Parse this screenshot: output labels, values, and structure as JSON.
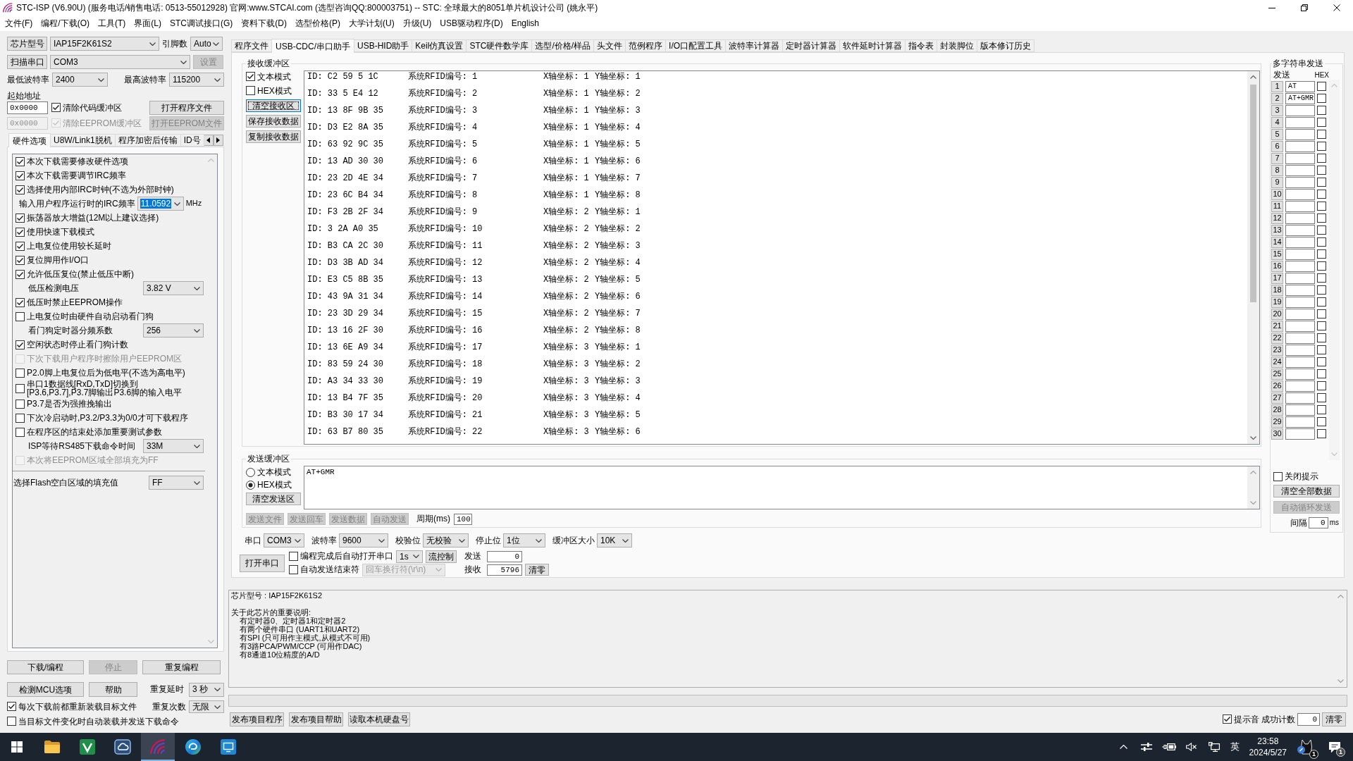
{
  "window": {
    "title": "STC-ISP (V6.90U) (服务电话/销售电话: 0513-55012928) 官网:www.STCAI.com  (选型咨询QQ:800003751) -- STC: 全球最大的8051单片机设计公司 (姚永平)"
  },
  "menu": [
    "文件(F)",
    "编程/下载(O)",
    "工具(T)",
    "界面(L)",
    "STC调试接口(G)",
    "资料下载(D)",
    "选型价格(P)",
    "大学计划(U)",
    "升级(U)",
    "USB驱动程序(D)",
    "English"
  ],
  "target": {
    "chip": {
      "button": "芯片型号",
      "value": "IAP15F2K61S2"
    },
    "pins": {
      "label": "引脚数",
      "value": "Auto"
    },
    "port": {
      "button": "扫描串口",
      "value": "COM3"
    },
    "setup_button": {
      "label": "设置",
      "disabled": true
    },
    "min_baud": {
      "label": "最低波特率",
      "value": "2400"
    },
    "max_baud": {
      "label": "最高波特率",
      "value": "115200"
    },
    "address_label": "起始地址",
    "buffers": [
      {
        "address": "0x0000",
        "clear_label": "清除代码缓冲区",
        "checked": true,
        "button": "打开程序文件",
        "disabled": false
      },
      {
        "address": "0x0000",
        "clear_label": "清除EEPROM缓冲区",
        "checked": true,
        "button": "打开EEPROM文件",
        "disabled": true
      }
    ]
  },
  "option_tabs": [
    {
      "label": "硬件选项",
      "selected": true
    },
    {
      "label": "U8W/Link1脱机",
      "selected": false
    },
    {
      "label": "程序加密后传输",
      "selected": false
    },
    {
      "label": "ID号",
      "selected": false
    }
  ],
  "hardware_options": [
    {
      "kind": "checkbox",
      "label": "本次下载需要修改硬件选项",
      "checked": true,
      "disabled": false
    },
    {
      "kind": "checkbox",
      "label": "本次下载需要调节IRC频率",
      "checked": true,
      "disabled": false
    },
    {
      "kind": "checkbox",
      "label": "选择使用内部IRC时钟(不选为外部时钟)",
      "checked": true,
      "disabled": false
    },
    {
      "kind": "frequency",
      "label": "输入用户程序运行时的IRC频率",
      "value": "11.0592",
      "highlighted": true,
      "unit": "MHz"
    },
    {
      "kind": "checkbox",
      "label": "振荡器放大增益(12M以上建议选择)",
      "checked": true,
      "disabled": false
    },
    {
      "kind": "checkbox",
      "label": "使用快速下载模式",
      "checked": true,
      "disabled": false
    },
    {
      "kind": "checkbox",
      "label": "上电复位使用较长延时",
      "checked": true,
      "disabled": false
    },
    {
      "kind": "checkbox",
      "label": "复位脚用作I/O口",
      "checked": true,
      "disabled": false
    },
    {
      "kind": "checkbox",
      "label": "允许低压复位(禁止低压中断)",
      "checked": true,
      "disabled": false
    },
    {
      "kind": "select",
      "label": "低压检测电压",
      "value": "3.82 V"
    },
    {
      "kind": "checkbox",
      "label": "低压时禁止EEPROM操作",
      "checked": true,
      "disabled": false
    },
    {
      "kind": "checkbox",
      "label": "上电复位时由硬件自动启动看门狗",
      "checked": false,
      "disabled": false
    },
    {
      "kind": "select",
      "label": "看门狗定时器分频系数",
      "value": "256"
    },
    {
      "kind": "checkbox",
      "label": "空闲状态时停止看门狗计数",
      "checked": true,
      "disabled": false
    },
    {
      "kind": "checkbox",
      "label": "下次下载用户程序时擦除用户EEPROM区",
      "checked": false,
      "disabled": true
    },
    {
      "kind": "checkbox",
      "label": "P2.0脚上电复位后为低电平(不选为高电平)",
      "checked": false,
      "disabled": false
    },
    {
      "kind": "checkbox",
      "label": "串口1数据线[RxD,TxD]切换到\n[P3.6,P3.7],P3.7脚输出P3.6脚的输入电平",
      "checked": false,
      "disabled": false
    },
    {
      "kind": "checkbox",
      "label": "P3.7是否为强推挽输出",
      "checked": false,
      "disabled": false
    },
    {
      "kind": "checkbox",
      "label": "下次冷启动时,P3.2/P3.3为0/0才可下载程序",
      "checked": false,
      "disabled": false
    },
    {
      "kind": "checkbox",
      "label": "在程序区的结束处添加重要测试参数",
      "checked": false,
      "disabled": false
    },
    {
      "kind": "select",
      "label": "ISP等待RS485下载命令时间",
      "value": "33M"
    },
    {
      "kind": "checkbox",
      "label": "本次将EEPROM区域全部填充为FF",
      "checked": false,
      "disabled": true
    },
    {
      "kind": "fill-select",
      "label": "选择Flash空白区域的填充值",
      "value": "FF"
    }
  ],
  "download": {
    "buttons": [
      {
        "label": "下载/编程",
        "disabled": false
      },
      {
        "label": "停止",
        "disabled": true
      },
      {
        "label": "重复编程",
        "disabled": false
      },
      {
        "label": "检测MCU选项",
        "disabled": false
      },
      {
        "label": "帮助",
        "disabled": false
      }
    ],
    "repeat_delay": {
      "label": "重复延时",
      "value": "3 秒"
    },
    "repeat_count": {
      "label": "重复次数",
      "value": "无限"
    },
    "reload": [
      {
        "label": "每次下载前都重新装载目标文件",
        "checked": true
      },
      {
        "label": "当目标文件变化时自动装载并发送下载命令",
        "checked": false
      }
    ]
  },
  "tabs": [
    {
      "label": "程序文件",
      "selected": false
    },
    {
      "label": "USB-CDC/串口助手",
      "selected": true
    },
    {
      "label": "USB-HID助手",
      "selected": false
    },
    {
      "label": "Keil仿真设置",
      "selected": false
    },
    {
      "label": "STC硬件数学库",
      "selected": false
    },
    {
      "label": "选型/价格/样品",
      "selected": false
    },
    {
      "label": "头文件",
      "selected": false
    },
    {
      "label": "范例程序",
      "selected": false
    },
    {
      "label": "I/O口配置工具",
      "selected": false
    },
    {
      "label": "波特率计算器",
      "selected": false
    },
    {
      "label": "定时器计算器",
      "selected": false
    },
    {
      "label": "软件延时计算器",
      "selected": false
    },
    {
      "label": "指令表",
      "selected": false
    },
    {
      "label": "封装脚位",
      "selected": false
    },
    {
      "label": "版本修订历史",
      "selected": false
    }
  ],
  "receive": {
    "title": "接收缓冲区",
    "modes": [
      {
        "label": "文本模式",
        "checked": true
      },
      {
        "label": "HEX模式",
        "checked": false
      }
    ],
    "buttons": [
      {
        "label": "清空接收区",
        "focused": true
      },
      {
        "label": "保存接收数据",
        "focused": false
      },
      {
        "label": "复制接收数据",
        "focused": false
      }
    ],
    "rows": [
      {
        "id": "ID: C2 59 5 1C",
        "number_label": "系统RFID编号:",
        "number": "1",
        "x": "X轴坐标: 1",
        "y": "Y轴坐标: 1"
      },
      {
        "id": "ID: 33 5 E4 12",
        "number_label": "系统RFID编号:",
        "number": "2",
        "x": "X轴坐标: 1",
        "y": "Y轴坐标: 2"
      },
      {
        "id": "ID: 13 8F 9B 35",
        "number_label": "系统RFID编号:",
        "number": "3",
        "x": "X轴坐标: 1",
        "y": "Y轴坐标: 3"
      },
      {
        "id": "ID: D3 E2 8A 35",
        "number_label": "系统RFID编号:",
        "number": "4",
        "x": "X轴坐标: 1",
        "y": "Y轴坐标: 4"
      },
      {
        "id": "ID: 63 92 9C 35",
        "number_label": "系统RFID编号:",
        "number": "5",
        "x": "X轴坐标: 1",
        "y": "Y轴坐标: 5"
      },
      {
        "id": "ID: 13 AD 30 30",
        "number_label": "系统RFID编号:",
        "number": "6",
        "x": "X轴坐标: 1",
        "y": "Y轴坐标: 6"
      },
      {
        "id": "ID: 23 2D 4E 34",
        "number_label": "系统RFID编号:",
        "number": "7",
        "x": "X轴坐标: 1",
        "y": "Y轴坐标: 7"
      },
      {
        "id": "ID: 23 6C B4 34",
        "number_label": "系统RFID编号:",
        "number": "8",
        "x": "X轴坐标: 1",
        "y": "Y轴坐标: 8"
      },
      {
        "id": "ID: F3 2B 2F 34",
        "number_label": "系统RFID编号:",
        "number": "9",
        "x": "X轴坐标: 2",
        "y": "Y轴坐标: 1"
      },
      {
        "id": "ID: 3 2A A0 35",
        "number_label": "系统RFID编号:",
        "number": "10",
        "x": "X轴坐标: 2",
        "y": "Y轴坐标: 2"
      },
      {
        "id": "ID: B3 CA 2C 30",
        "number_label": "系统RFID编号:",
        "number": "11",
        "x": "X轴坐标: 2",
        "y": "Y轴坐标: 3"
      },
      {
        "id": "ID: D3 3B AD 34",
        "number_label": "系统RFID编号:",
        "number": "12",
        "x": "X轴坐标: 2",
        "y": "Y轴坐标: 4"
      },
      {
        "id": "ID: E3 C5 8B 35",
        "number_label": "系统RFID编号:",
        "number": "13",
        "x": "X轴坐标: 2",
        "y": "Y轴坐标: 5"
      },
      {
        "id": "ID: 43 9A 31 34",
        "number_label": "系统RFID编号:",
        "number": "14",
        "x": "X轴坐标: 2",
        "y": "Y轴坐标: 6"
      },
      {
        "id": "ID: 23 3D 29 34",
        "number_label": "系统RFID编号:",
        "number": "15",
        "x": "X轴坐标: 2",
        "y": "Y轴坐标: 7"
      },
      {
        "id": "ID: 13 16 2F 30",
        "number_label": "系统RFID编号:",
        "number": "16",
        "x": "X轴坐标: 2",
        "y": "Y轴坐标: 8"
      },
      {
        "id": "ID: 13 6E A9 34",
        "number_label": "系统RFID编号:",
        "number": "17",
        "x": "X轴坐标: 3",
        "y": "Y轴坐标: 1"
      },
      {
        "id": "ID: 83 59 24 30",
        "number_label": "系统RFID编号:",
        "number": "18",
        "x": "X轴坐标: 3",
        "y": "Y轴坐标: 2"
      },
      {
        "id": "ID: A3 34 33 30",
        "number_label": "系统RFID编号:",
        "number": "19",
        "x": "X轴坐标: 3",
        "y": "Y轴坐标: 3"
      },
      {
        "id": "ID: 13 B4 7F 35",
        "number_label": "系统RFID编号:",
        "number": "20",
        "x": "X轴坐标: 3",
        "y": "Y轴坐标: 4"
      },
      {
        "id": "ID: B3 30 17 34",
        "number_label": "系统RFID编号:",
        "number": "21",
        "x": "X轴坐标: 3",
        "y": "Y轴坐标: 5"
      },
      {
        "id": "ID: 63 B7 80 35",
        "number_label": "系统RFID编号:",
        "number": "22",
        "x": "X轴坐标: 3",
        "y": "Y轴坐标: 6"
      }
    ]
  },
  "send": {
    "title": "发送缓冲区",
    "modes": [
      {
        "label": "文本模式",
        "selected": false
      },
      {
        "label": "HEX模式",
        "selected": true
      }
    ],
    "clear_button": "清空发送区",
    "text": "AT+GMR",
    "actions": [
      {
        "label": "发送文件",
        "disabled": true
      },
      {
        "label": "发送回车",
        "disabled": true
      },
      {
        "label": "发送数据",
        "disabled": true
      },
      {
        "label": "自动发送",
        "disabled": true
      }
    ],
    "period": {
      "label": "周期(ms)",
      "value": "100"
    }
  },
  "serial": {
    "settings": [
      {
        "label": "串口",
        "value": "COM3"
      },
      {
        "label": "波特率",
        "value": "9600"
      },
      {
        "label": "校验位",
        "value": "无校验"
      },
      {
        "label": "停止位",
        "value": "1位"
      },
      {
        "label": "缓冲区大小",
        "value": "10K"
      }
    ],
    "open_button": "打开串口",
    "auto_open": {
      "label": "编程完成后自动打开串口",
      "checked": false,
      "delay": "1s"
    },
    "flow_button": "流控制",
    "sent": {
      "label": "发送",
      "value": "0"
    },
    "auto_end": {
      "label": "自动发送结束符",
      "checked": false,
      "ending": "回车换行符(\\r\\n)",
      "ending_disabled": true
    },
    "received": {
      "label": "接收",
      "value": "5796"
    },
    "clear_button": "清零"
  },
  "multi_send": {
    "title": "多字符串发送",
    "send_header": "发送",
    "hex_header": "HEX",
    "rows": [
      {
        "number": "1",
        "text": "AT",
        "hex": false
      },
      {
        "number": "2",
        "text": "AT+GMR",
        "hex": false
      },
      {
        "number": "3",
        "hex": false
      },
      {
        "number": "4",
        "hex": false
      },
      {
        "number": "5",
        "hex": false
      },
      {
        "number": "6",
        "hex": false
      },
      {
        "number": "7",
        "hex": false
      },
      {
        "number": "8",
        "hex": false
      },
      {
        "number": "9",
        "hex": false
      },
      {
        "number": "10",
        "hex": false
      },
      {
        "number": "11",
        "hex": false
      },
      {
        "number": "12",
        "hex": false
      },
      {
        "number": "13",
        "hex": false
      },
      {
        "number": "14",
        "hex": false
      },
      {
        "number": "15",
        "hex": false
      },
      {
        "number": "16",
        "hex": false
      },
      {
        "number": "17",
        "hex": false
      },
      {
        "number": "18",
        "hex": false
      },
      {
        "number": "19",
        "hex": false
      },
      {
        "number": "20",
        "hex": false
      },
      {
        "number": "21",
        "hex": false
      },
      {
        "number": "22",
        "hex": false
      },
      {
        "number": "23",
        "hex": false
      },
      {
        "number": "24",
        "hex": false
      },
      {
        "number": "25",
        "hex": false
      },
      {
        "number": "26",
        "hex": false
      },
      {
        "number": "27",
        "hex": false
      },
      {
        "number": "28",
        "hex": false
      },
      {
        "number": "29",
        "hex": false
      },
      {
        "number": "30",
        "hex": false
      }
    ],
    "close_hint": {
      "label": "关闭提示",
      "checked": false
    },
    "clear_button": "清空全部数据",
    "loop_button": {
      "label": "自动循环发送",
      "disabled": true
    },
    "interval": {
      "label": "间隔",
      "value": "0",
      "unit": "ms"
    }
  },
  "info": {
    "chip_line": "芯片型号 : IAP15F2K61S2",
    "notes_title": "关于此芯片的重要说明:",
    "notes": [
      "有定时器0、定时器1和定时器2",
      "有两个硬件串口 (UART1和UART2)",
      "有SPI (只可用作主模式,从模式不可用)",
      "有3路PCA/PWM/CCP (可用作DAC)",
      "有8通道10位精度的A/D"
    ]
  },
  "footer": {
    "buttons": [
      "发布项目程序",
      "发布项目帮助",
      "读取本机硬盘号"
    ],
    "beep": {
      "label": "提示音",
      "checked": true
    },
    "success_count": {
      "label": "成功计数",
      "value": "0"
    },
    "clear_button": "清零"
  },
  "taskbar": {
    "apps": [
      {
        "kind": "folder",
        "active": false
      },
      {
        "kind": "tile",
        "active": false
      },
      {
        "kind": "cloud",
        "active": false
      },
      {
        "kind": "arcs",
        "active": true
      },
      {
        "kind": "swirl",
        "active": false
      },
      {
        "kind": "monitor",
        "active": false
      }
    ],
    "input_method": "英",
    "time": "23:58",
    "date": "2024/5/27",
    "badge": "1",
    "notification_badge": "1"
  }
}
